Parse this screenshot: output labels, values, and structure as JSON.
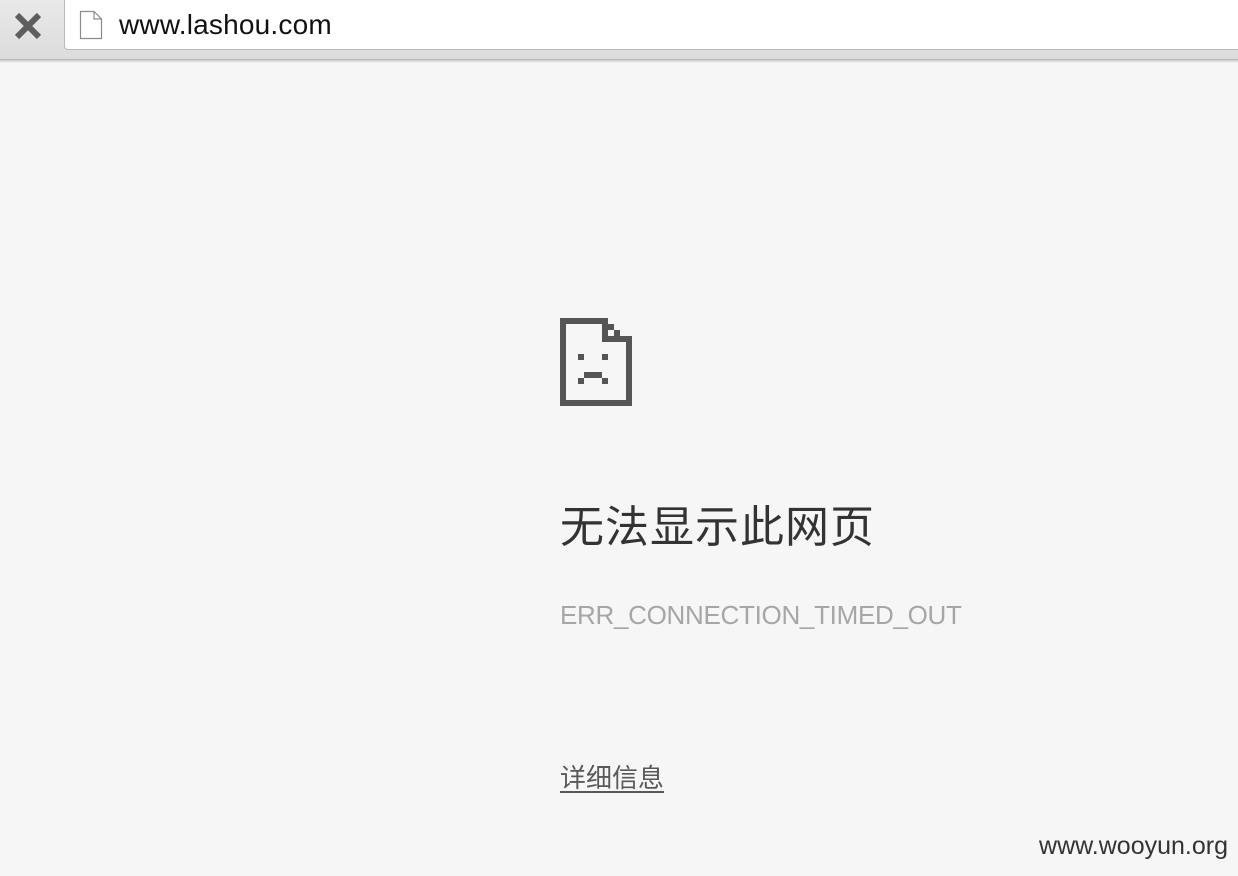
{
  "browser": {
    "address_bar": {
      "url": "www.lashou.com",
      "page_icon": "page-icon"
    },
    "stop_button": {
      "icon": "close-icon"
    }
  },
  "error_page": {
    "icon": "sad-file-icon",
    "title": "无法显示此网页",
    "error_code": "ERR_CONNECTION_TIMED_OUT",
    "details_link": "详细信息"
  },
  "watermark": "www.wooyun.org",
  "colors": {
    "background": "#f6f6f6",
    "title_text": "#333333",
    "error_code_text": "#a6a6a6",
    "icon": "#555555"
  }
}
